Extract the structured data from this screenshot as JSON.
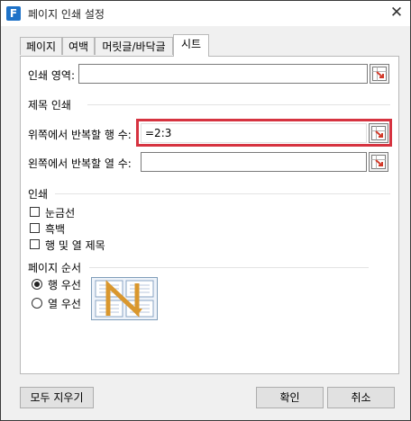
{
  "window": {
    "title": "페이지 인쇄 설정",
    "app_icon_letter": "F",
    "close_glyph": "✕"
  },
  "tabs": [
    {
      "label": "페이지",
      "active": false
    },
    {
      "label": "여백",
      "active": false
    },
    {
      "label": "머릿글/바닥글",
      "active": false
    },
    {
      "label": "시트",
      "active": true
    }
  ],
  "sheet": {
    "print_area_label": "인쇄 영역:",
    "print_area_value": "",
    "print_titles_heading": "제목 인쇄",
    "rows_repeat_label": "위쪽에서 반복할 행 수:",
    "rows_repeat_value": "=2:3",
    "cols_repeat_label": "왼쪽에서 반복할 열 수:",
    "cols_repeat_value": "",
    "print_heading": "인쇄",
    "checkboxes": [
      {
        "label": "눈금선",
        "checked": false
      },
      {
        "label": "흑백",
        "checked": false
      },
      {
        "label": "행 및 열 제목",
        "checked": false
      }
    ],
    "page_order_heading": "페이지 순서",
    "page_order_options": [
      {
        "label": "행 우선",
        "checked": true
      },
      {
        "label": "열 우선",
        "checked": false
      }
    ]
  },
  "buttons": {
    "clear_all": "모두 지우기",
    "ok": "확인",
    "cancel": "취소"
  },
  "colors": {
    "highlight_border": "#d63340",
    "app_icon": "#1e72c8",
    "order_arrow": "#d9972e"
  }
}
